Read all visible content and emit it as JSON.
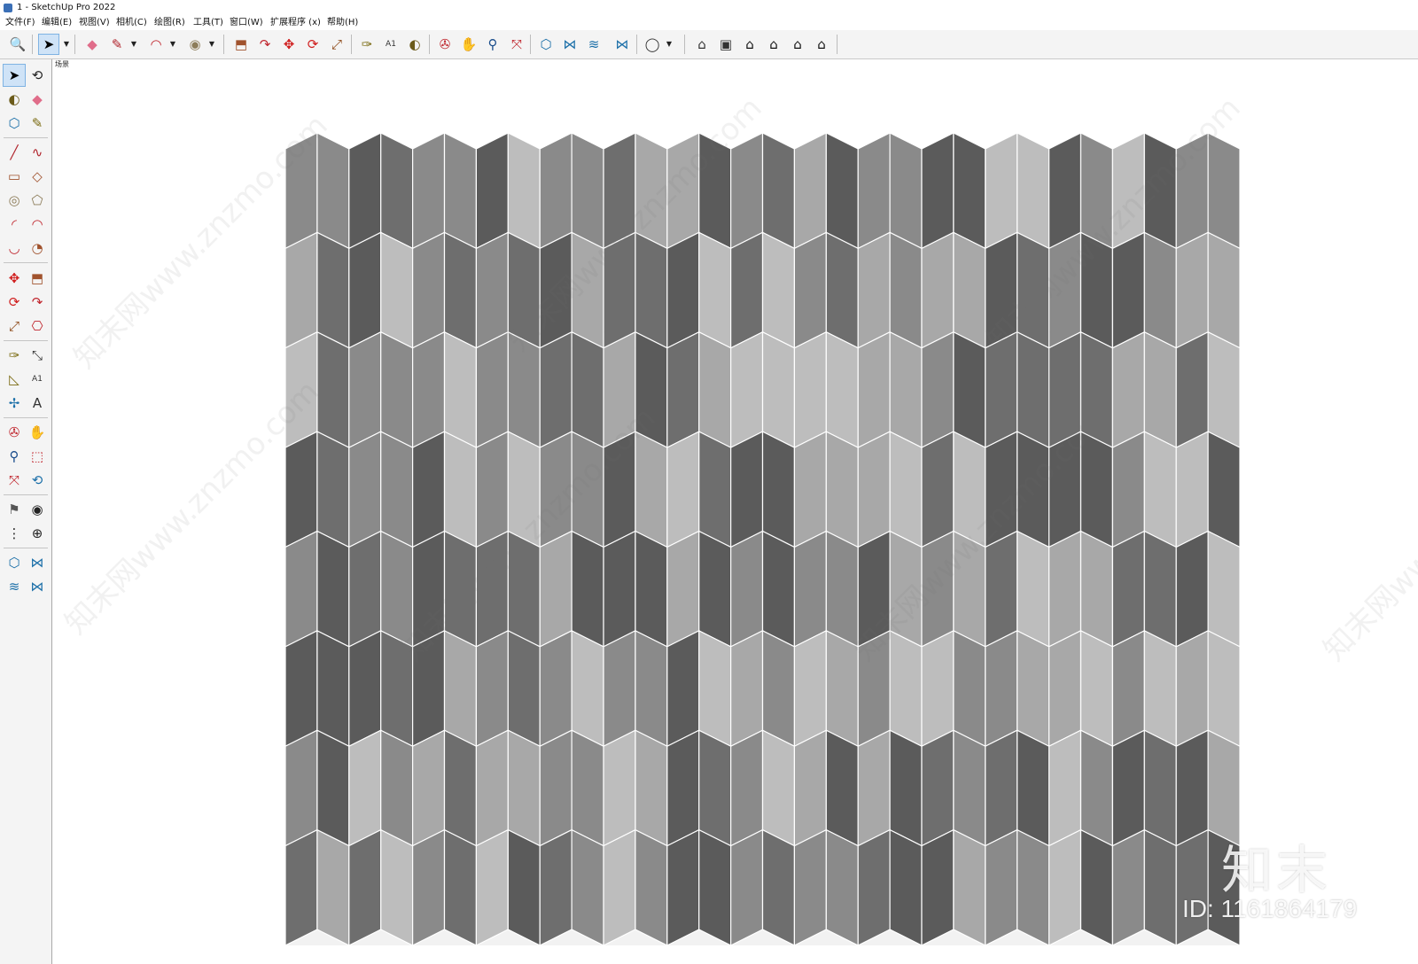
{
  "window": {
    "title": "1 - SketchUp Pro 2022"
  },
  "menu": [
    "文件(F)",
    "编辑(E)",
    "视图(V)",
    "相机(C)",
    "绘图(R)",
    "工具(T)",
    "窗口(W)",
    "扩展程序 (x)",
    "帮助(H)"
  ],
  "toolbar": {
    "zoom": "🔍",
    "select": "➤",
    "eraser": "◆",
    "pencil": "✎",
    "arc": "◠",
    "circle": "◉",
    "pushpull": "⬒",
    "followme": "↷",
    "move": "✥",
    "rotate": "⟳",
    "scale": "⤢",
    "tape": "✑",
    "text": "A1",
    "paint": "◐",
    "orbit": "✇",
    "pan": "✋",
    "zoom_tool": "⚲",
    "zoom_extents": "⤧",
    "warehouse": "⬡",
    "ext1": "⋈",
    "ext2": "≋",
    "ext3": "⋈",
    "account": "◯",
    "view_iso": "⌂",
    "view_top": "▣",
    "view_front": "⌂",
    "view_right": "⌂",
    "view_back": "⌂",
    "view_left": "⌂",
    "dropdown": "▼"
  },
  "sidebar": {
    "select": "➤",
    "orbit": "⟲",
    "paint": "◐",
    "eraser": "◆",
    "component": "⬡",
    "tag": "✎",
    "line": "╱",
    "freehand": "∿",
    "rect": "▭",
    "rot_rect": "◇",
    "circle": "◎",
    "polygon": "⬠",
    "arc": "◜",
    "arc2": "◠",
    "arc3": "◡",
    "pie": "◔",
    "move": "✥",
    "pushpull": "⬒",
    "rotate": "⟳",
    "followme": "↷",
    "scale": "⤢",
    "offset": "⎔",
    "tape": "✑",
    "dimension": "⤡",
    "protractor": "◺",
    "text": "A1",
    "axes": "✢",
    "text3d": "A",
    "orbit2": "✇",
    "pan": "✋",
    "zoom": "⚲",
    "zoom_window": "⬚",
    "zoom_extents": "⤧",
    "prev": "⟲",
    "position_camera": "⚑",
    "look_around": "◉",
    "walk": "⋮",
    "section": "⊕",
    "warehouse": "⬡",
    "ext_wh": "⋈",
    "ext_layer": "≋",
    "ext_manager": "⋈"
  },
  "viewport": {
    "scene_tab": "场景"
  },
  "tiles": {
    "columns": 30,
    "rows": 8,
    "palette": [
      "#5b5b5b",
      "#6e6e6e",
      "#8a8a8a",
      "#a8a8a8",
      "#bdbdbd"
    ]
  },
  "watermark": {
    "text": "知末网www.znzmo.com"
  },
  "brand": {
    "logo": "知末",
    "id": "ID: 1161864179"
  }
}
